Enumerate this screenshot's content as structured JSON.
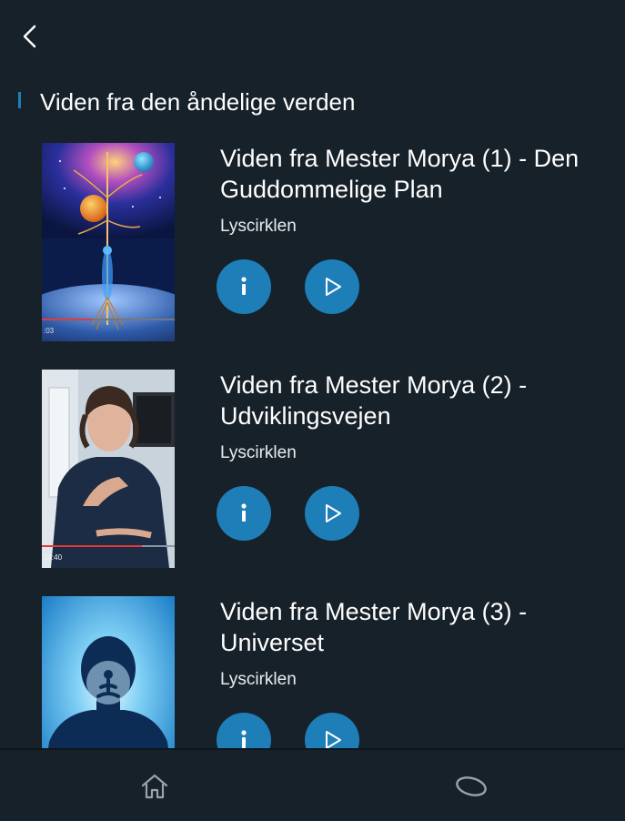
{
  "header": {
    "back_icon": "back-arrow-icon"
  },
  "section": {
    "title": "Viden fra den åndelige verden",
    "accent_color": "#1e7fb8"
  },
  "items": [
    {
      "title": "Viden fra Mester Morya (1) - Den Guddommelige Plan",
      "author": "Lyscirklen",
      "duration": ":03"
    },
    {
      "title": "Viden fra Mester Morya (2) - Udviklingsvejen",
      "author": "Lyscirklen",
      "duration": "14:40"
    },
    {
      "title": "Viden fra Mester Morya (3) - Universet",
      "author": "Lyscirklen",
      "duration": ""
    }
  ],
  "buttons": {
    "info_icon": "info-icon",
    "play_icon": "play-icon",
    "color": "#1e7fb8"
  },
  "bottom_nav": {
    "items": [
      "home-icon",
      "ellipse-icon"
    ]
  },
  "colors": {
    "background": "#17212a",
    "accent": "#1e7fb8",
    "progress": "#e53935"
  }
}
